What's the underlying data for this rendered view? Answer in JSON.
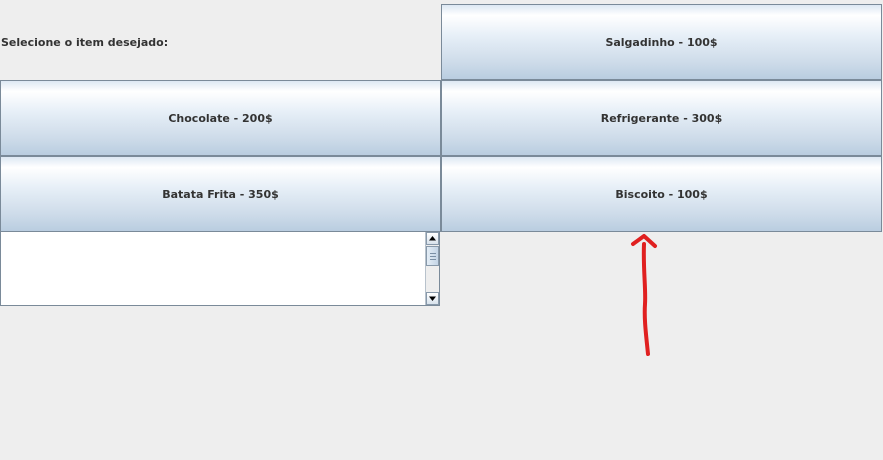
{
  "prompt": {
    "label": "Selecione o item desejado:"
  },
  "items": {
    "salgadinho": "Salgadinho - 100$",
    "chocolate": "Chocolate - 200$",
    "refrigerante": "Refrigerante - 300$",
    "batata": "Batata Frita - 350$",
    "biscoito": "Biscoito - 100$"
  },
  "output": {
    "text": ""
  },
  "colors": {
    "window_bg": "#eeeeee",
    "button_border": "#7a8a99",
    "button_text": "#333333",
    "annotation": "#e02020"
  },
  "icons": {
    "scroll_up": "scroll-up-arrow-icon",
    "scroll_down": "scroll-down-arrow-icon",
    "annotation": "hand-drawn-red-arrow"
  }
}
